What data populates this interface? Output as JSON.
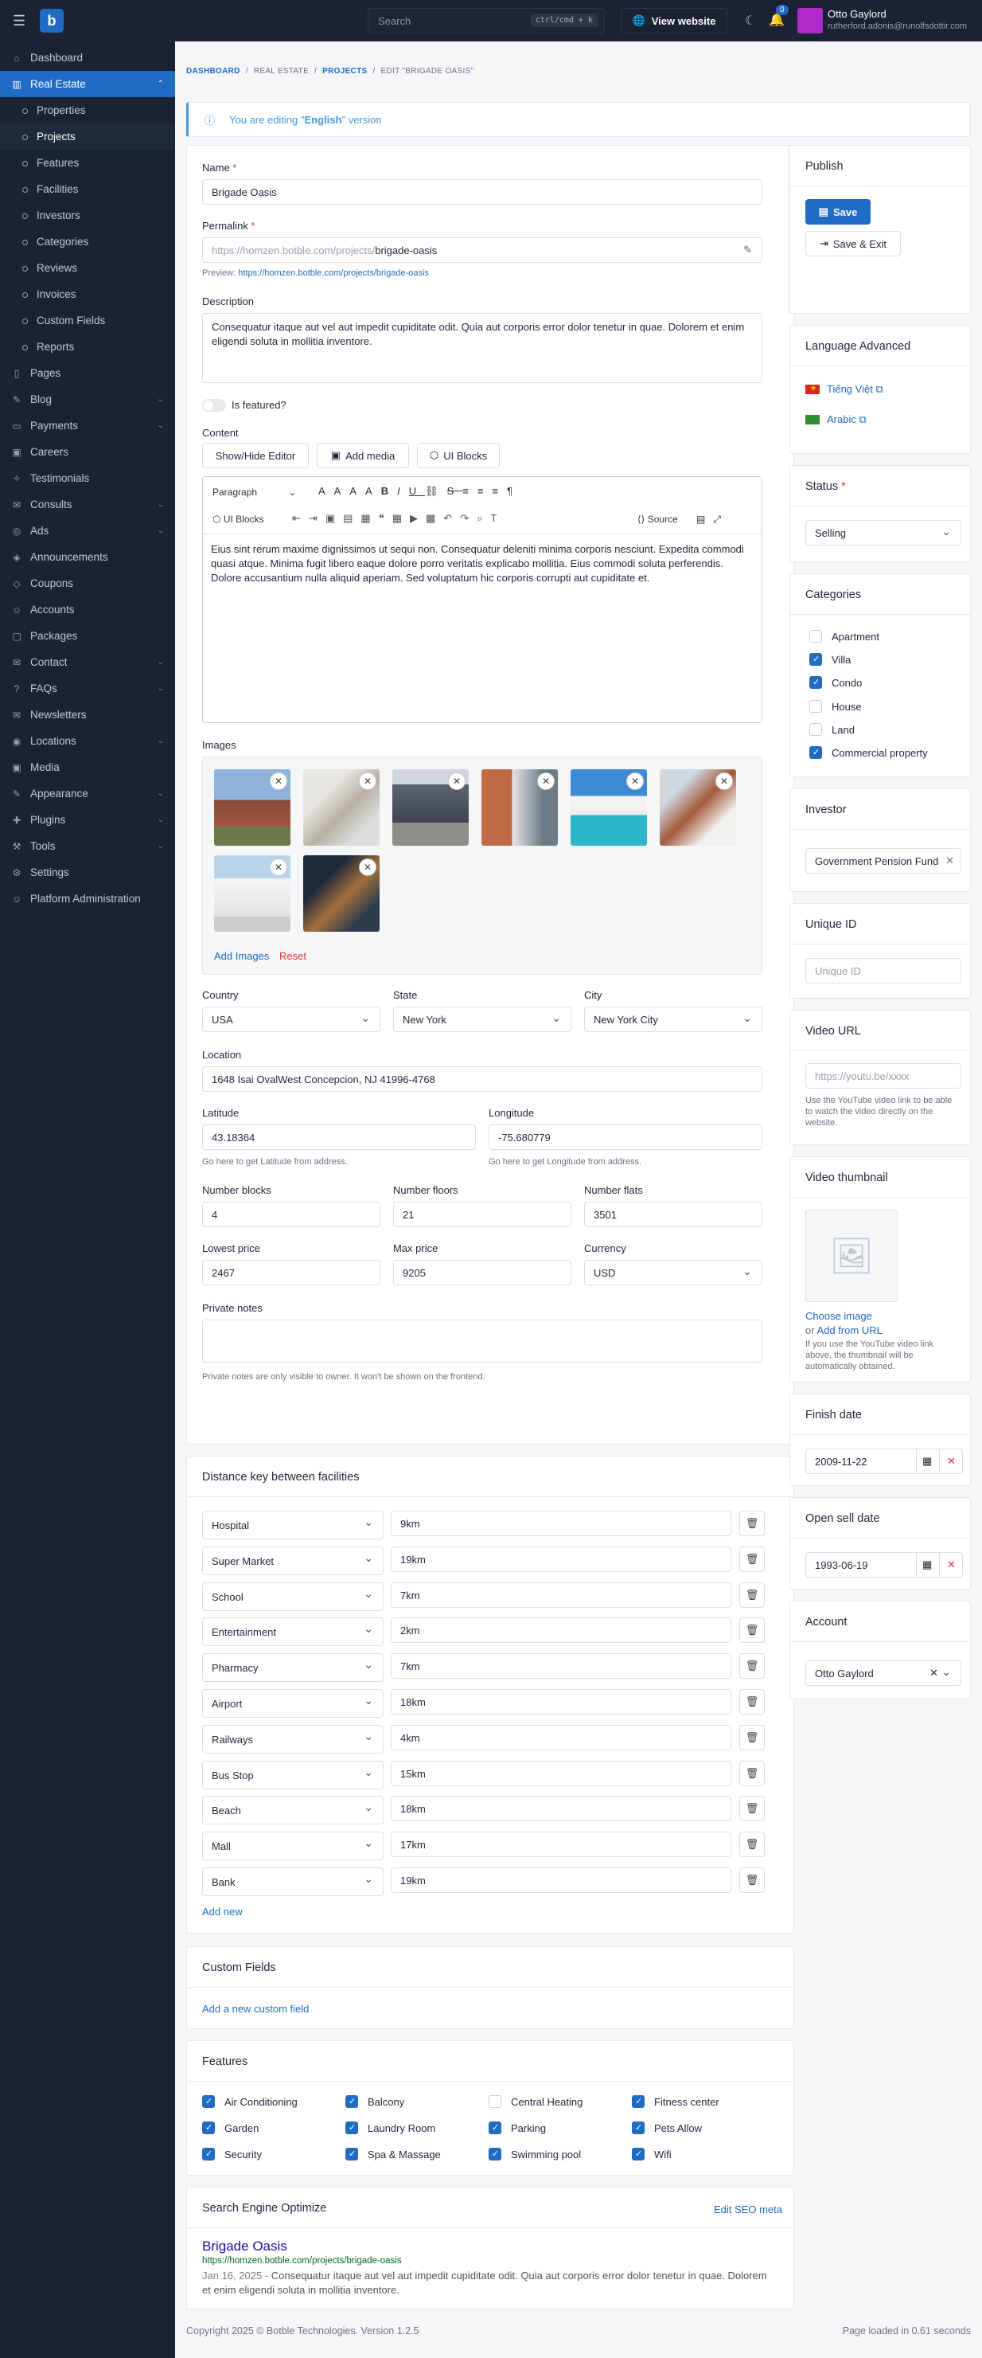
{
  "topbar": {
    "search_placeholder": "Search",
    "search_kbd": "ctrl/cmd + k",
    "view_website": "View website",
    "notif_count": "0",
    "user_name": "Otto Gaylord",
    "user_email": "rutherford.adonis@runolfsdottir.com"
  },
  "sidebar": {
    "items": [
      {
        "label": "Dashboard",
        "icon": "home-icon"
      },
      {
        "label": "Real Estate",
        "icon": "building-icon",
        "active": true
      },
      {
        "label": "Properties",
        "sub": true
      },
      {
        "label": "Projects",
        "sub": true,
        "current": true
      },
      {
        "label": "Features",
        "sub": true
      },
      {
        "label": "Facilities",
        "sub": true
      },
      {
        "label": "Investors",
        "sub": true
      },
      {
        "label": "Categories",
        "sub": true
      },
      {
        "label": "Reviews",
        "sub": true
      },
      {
        "label": "Invoices",
        "sub": true
      },
      {
        "label": "Custom Fields",
        "sub": true
      },
      {
        "label": "Reports",
        "sub": true
      },
      {
        "label": "Pages",
        "icon": "page-icon"
      },
      {
        "label": "Blog",
        "icon": "blog-icon",
        "chev": true
      },
      {
        "label": "Payments",
        "icon": "payment-icon",
        "chev": true
      },
      {
        "label": "Careers",
        "icon": "career-icon"
      },
      {
        "label": "Testimonials",
        "icon": "testimonial-icon"
      },
      {
        "label": "Consults",
        "icon": "consult-icon",
        "chev": true
      },
      {
        "label": "Ads",
        "icon": "ads-icon",
        "chev": true
      },
      {
        "label": "Announcements",
        "icon": "announce-icon"
      },
      {
        "label": "Coupons",
        "icon": "coupon-icon"
      },
      {
        "label": "Accounts",
        "icon": "accounts-icon"
      },
      {
        "label": "Packages",
        "icon": "package-icon"
      },
      {
        "label": "Contact",
        "icon": "contact-icon",
        "chev": true
      },
      {
        "label": "FAQs",
        "icon": "faq-icon",
        "chev": true
      },
      {
        "label": "Newsletters",
        "icon": "newsletter-icon"
      },
      {
        "label": "Locations",
        "icon": "location-icon",
        "chev": true
      },
      {
        "label": "Media",
        "icon": "media-icon"
      },
      {
        "label": "Appearance",
        "icon": "appearance-icon",
        "chev": true
      },
      {
        "label": "Plugins",
        "icon": "plugin-icon",
        "chev": true
      },
      {
        "label": "Tools",
        "icon": "tools-icon",
        "chev": true
      },
      {
        "label": "Settings",
        "icon": "settings-icon"
      },
      {
        "label": "Platform Administration",
        "icon": "admin-icon"
      }
    ]
  },
  "breadcrumb": {
    "dashboard": "Dashboard",
    "real_estate": "Real Estate",
    "projects": "Projects",
    "current": "Edit \"Brigade Oasis\""
  },
  "alert": {
    "prefix": "You are editing \"",
    "lang": "English",
    "suffix": "\" version"
  },
  "form": {
    "name_label": "Name",
    "name_value": "Brigade Oasis",
    "permalink_label": "Permalink",
    "permalink_prefix": "https://homzen.botble.com/projects/",
    "permalink_slug": "brigade-oasis",
    "preview_label": "Preview:",
    "preview_url": "https://homzen.botble.com/projects/brigade-oasis",
    "description_label": "Description",
    "description_value": "Consequatur itaque aut vel aut impedit cupiditate odit. Quia aut corporis error dolor tenetur in quae. Dolorem et enim eligendi soluta in mollitia inventore.",
    "featured_label": "Is featured?",
    "content_label": "Content",
    "btn_showhide": "Show/Hide Editor",
    "btn_add_media": "Add media",
    "btn_ui_blocks": "UI Blocks",
    "editor_paragraph": "Paragraph",
    "editor_ui_blocks": "UI Blocks",
    "editor_source": "Source",
    "content_value": "Eius sint rerum maxime dignissimos ut sequi non. Consequatur deleniti minima corporis nesciunt. Expedita commodi quasi atque. Minima fugit libero eaque dolore porro veritatis explicabo mollitia. Eius commodi soluta perferendis. Dolore accusantium nulla aliquid aperiam. Sed voluptatum hic corporis corrupti aut cupiditate et.",
    "images_label": "Images",
    "add_images": "Add Images",
    "reset": "Reset",
    "country_label": "Country",
    "country_value": "USA",
    "state_label": "State",
    "state_value": "New York",
    "city_label": "City",
    "city_value": "New York City",
    "location_label": "Location",
    "location_value": "1648 Isai OvalWest Concepcion, NJ 41996-4768",
    "latitude_label": "Latitude",
    "latitude_value": "43.18364",
    "latitude_help": "Go here to get Latitude from address.",
    "longitude_label": "Longitude",
    "longitude_value": "-75.680779",
    "longitude_help": "Go here to get Longitude from address.",
    "blocks_label": "Number blocks",
    "blocks_value": "4",
    "floors_label": "Number floors",
    "floors_value": "21",
    "flats_label": "Number flats",
    "flats_value": "3501",
    "lowest_label": "Lowest price",
    "lowest_value": "2467",
    "max_label": "Max price",
    "max_value": "9205",
    "currency_label": "Currency",
    "currency_value": "USD",
    "private_label": "Private notes",
    "private_help": "Private notes are only visible to owner. It won't be shown on the frontend."
  },
  "distance": {
    "title": "Distance key between facilities",
    "add_new": "Add new",
    "rows": [
      {
        "facility": "Hospital",
        "value": "9km"
      },
      {
        "facility": "Super Market",
        "value": "19km"
      },
      {
        "facility": "School",
        "value": "7km"
      },
      {
        "facility": "Entertainment",
        "value": "2km"
      },
      {
        "facility": "Pharmacy",
        "value": "7km"
      },
      {
        "facility": "Airport",
        "value": "18km"
      },
      {
        "facility": "Railways",
        "value": "4km"
      },
      {
        "facility": "Bus Stop",
        "value": "15km"
      },
      {
        "facility": "Beach",
        "value": "18km"
      },
      {
        "facility": "Mall",
        "value": "17km"
      },
      {
        "facility": "Bank",
        "value": "19km"
      }
    ]
  },
  "custom_fields": {
    "title": "Custom Fields",
    "add": "Add a new custom field"
  },
  "features": {
    "title": "Features",
    "items": [
      {
        "label": "Air Conditioning",
        "checked": true
      },
      {
        "label": "Balcony",
        "checked": true
      },
      {
        "label": "Central Heating",
        "checked": false
      },
      {
        "label": "Fitness center",
        "checked": true
      },
      {
        "label": "Garden",
        "checked": true
      },
      {
        "label": "Laundry Room",
        "checked": true
      },
      {
        "label": "Parking",
        "checked": true
      },
      {
        "label": "Pets Allow",
        "checked": true
      },
      {
        "label": "Security",
        "checked": true
      },
      {
        "label": "Spa & Massage",
        "checked": true
      },
      {
        "label": "Swimming pool",
        "checked": true
      },
      {
        "label": "Wifi",
        "checked": true
      }
    ]
  },
  "seo": {
    "title": "Search Engine Optimize",
    "edit": "Edit SEO meta",
    "preview_title": "Brigade Oasis",
    "preview_url": "https://homzen.botble.com/projects/brigade-oasis",
    "preview_date": "Jan 16, 2025 -",
    "preview_desc": "Consequatur itaque aut vel aut impedit cupiditate odit. Quia aut corporis error dolor tenetur in quae. Dolorem et enim eligendi soluta in mollitia inventore."
  },
  "publish": {
    "title": "Publish",
    "save": "Save",
    "save_exit": "Save & Exit"
  },
  "language": {
    "title": "Language Advanced",
    "vi": "Tiếng Việt",
    "ar": "Arabic"
  },
  "status": {
    "title": "Status",
    "value": "Selling"
  },
  "categories": {
    "title": "Categories",
    "items": [
      {
        "label": "Apartment",
        "checked": false
      },
      {
        "label": "Villa",
        "checked": true
      },
      {
        "label": "Condo",
        "checked": true
      },
      {
        "label": "House",
        "checked": false
      },
      {
        "label": "Land",
        "checked": false
      },
      {
        "label": "Commercial property",
        "checked": true
      }
    ]
  },
  "investor": {
    "title": "Investor",
    "value": "Government Pension Fund"
  },
  "unique_id": {
    "title": "Unique ID",
    "placeholder": "Unique ID"
  },
  "video_url": {
    "title": "Video URL",
    "placeholder": "https://youtu.be/xxxx",
    "help": "Use the YouTube video link to be able to watch the video directly on the website."
  },
  "video_thumb": {
    "title": "Video thumbnail",
    "choose": "Choose image",
    "or": "or",
    "add_url": "Add from URL",
    "help": "If you use the YouTube video link above, the thumbnail will be automatically obtained."
  },
  "finish_date": {
    "title": "Finish date",
    "value": "2009-11-22"
  },
  "open_date": {
    "title": "Open sell date",
    "value": "1993-06-19"
  },
  "account": {
    "title": "Account",
    "value": "Otto Gaylord"
  },
  "footer": {
    "copyright": "Copyright 2025 © Botble Technologies. Version 1.2.5",
    "loaded": "Page loaded in 0.61 seconds"
  },
  "colors": {
    "primary": "#206bc4",
    "sidebar": "#1a2234",
    "danger": "#d63939"
  }
}
